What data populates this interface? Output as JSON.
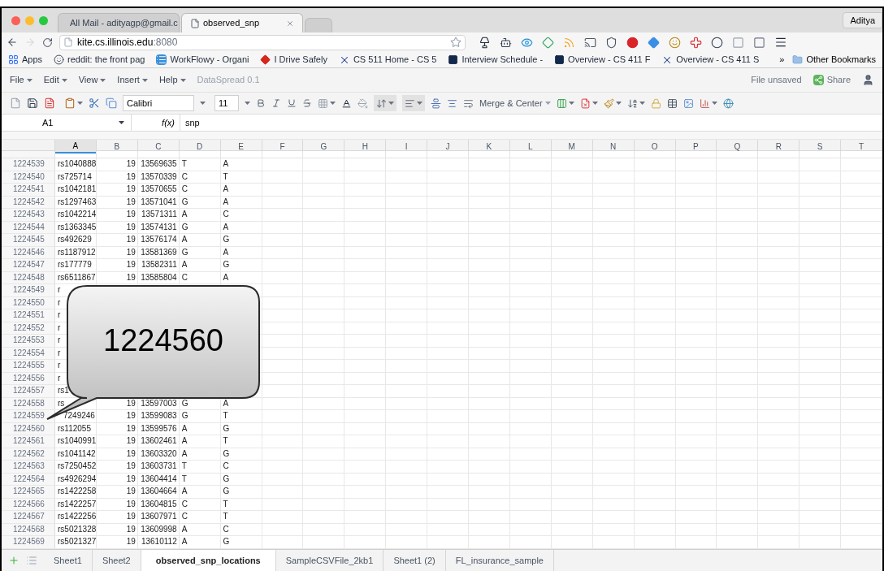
{
  "browser": {
    "tabs": [
      {
        "title": "All Mail - adityagp@gmail.c",
        "kind": "mail",
        "selected": false
      },
      {
        "title": "observed_snp",
        "kind": "doc",
        "selected": true
      }
    ],
    "profile": "Aditya",
    "url": {
      "host": "kite.cs.illinois.edu",
      "port": ":8080"
    },
    "bookmarks": [
      {
        "label": "Apps",
        "kind": "apps"
      },
      {
        "label": "reddit: the front pag",
        "kind": "face"
      },
      {
        "label": "WorkFlowy - Organi",
        "kind": "list"
      },
      {
        "label": "I Drive Safely",
        "kind": "diamond"
      },
      {
        "label": "CS 511 Home - CS 5",
        "kind": "x"
      },
      {
        "label": "Interview Schedule -",
        "kind": "square"
      },
      {
        "label": "Overview - CS 411 F",
        "kind": "square"
      },
      {
        "label": "Overview - CS 411 S",
        "kind": "x"
      }
    ],
    "more": "»",
    "other_bookmarks": "Other Bookmarks"
  },
  "app": {
    "menus": [
      "File",
      "Edit",
      "View",
      "Insert",
      "Help"
    ],
    "product": "DataSpread 0.1",
    "save_status": "File unsaved",
    "share": "Share"
  },
  "toolbar": {
    "font": "Calibri",
    "size": "11",
    "merge": "Merge & Center"
  },
  "formula_bar": {
    "cell": "A1",
    "fx": "f(x)",
    "value": "snp"
  },
  "sheet": {
    "columns": [
      {
        "label": "A",
        "selected": true
      },
      {
        "label": "B",
        "selected": false
      },
      {
        "label": "C",
        "selected": false
      },
      {
        "label": "D",
        "selected": false
      },
      {
        "label": "E",
        "selected": false
      },
      {
        "label": "F",
        "selected": false
      },
      {
        "label": "G",
        "selected": false
      },
      {
        "label": "H",
        "selected": false
      },
      {
        "label": "I",
        "selected": false
      },
      {
        "label": "J",
        "selected": false
      },
      {
        "label": "K",
        "selected": false
      },
      {
        "label": "L",
        "selected": false
      },
      {
        "label": "M",
        "selected": false
      },
      {
        "label": "N",
        "selected": false
      },
      {
        "label": "O",
        "selected": false
      },
      {
        "label": "P",
        "selected": false
      },
      {
        "label": "Q",
        "selected": false
      },
      {
        "label": "R",
        "selected": false
      },
      {
        "label": "S",
        "selected": false
      },
      {
        "label": "T",
        "selected": false
      }
    ],
    "rows": [
      {
        "number": "1224539",
        "cells": [
          "rs1040888",
          "19",
          "13569635",
          "T",
          "A"
        ]
      },
      {
        "number": "1224540",
        "cells": [
          "rs725714",
          "19",
          "13570339",
          "C",
          "T"
        ]
      },
      {
        "number": "1224541",
        "cells": [
          "rs1042181",
          "19",
          "13570655",
          "C",
          "A"
        ]
      },
      {
        "number": "1224542",
        "cells": [
          "rs1297463",
          "19",
          "13571041",
          "G",
          "A"
        ]
      },
      {
        "number": "1224543",
        "cells": [
          "rs1042214",
          "19",
          "13571311",
          "A",
          "C"
        ]
      },
      {
        "number": "1224544",
        "cells": [
          "rs1363345",
          "19",
          "13574131",
          "G",
          "A"
        ]
      },
      {
        "number": "1224545",
        "cells": [
          "rs492629",
          "19",
          "13576174",
          "A",
          "G"
        ]
      },
      {
        "number": "1224546",
        "cells": [
          "rs1187912",
          "19",
          "13581369",
          "G",
          "A"
        ]
      },
      {
        "number": "1224547",
        "cells": [
          "rs177779",
          "19",
          "13582311",
          "A",
          "G"
        ]
      },
      {
        "number": "1224548",
        "cells": [
          "rs6511867",
          "19",
          "13585804",
          "C",
          "A"
        ]
      },
      {
        "number": "1224549",
        "cells": [
          "r"
        ]
      },
      {
        "number": "1224550",
        "cells": [
          "r"
        ]
      },
      {
        "number": "1224551",
        "cells": [
          "r"
        ]
      },
      {
        "number": "1224552",
        "cells": [
          "r"
        ]
      },
      {
        "number": "1224553",
        "cells": [
          "r"
        ]
      },
      {
        "number": "1224554",
        "cells": [
          "r"
        ]
      },
      {
        "number": "1224555",
        "cells": [
          "r"
        ]
      },
      {
        "number": "1224556",
        "cells": [
          "r"
        ]
      },
      {
        "number": "1224557",
        "cells": [
          "rs1"
        ]
      },
      {
        "number": "1224558",
        "cells": [
          "rs",
          "19",
          "13597003",
          "G",
          "A"
        ]
      },
      {
        "number": "1224559",
        "cells": [
          {
            "text": "7249246",
            "kind": "covered"
          },
          "19",
          "13599083",
          "G",
          "T"
        ]
      },
      {
        "number": "1224560",
        "cells": [
          "rs112055",
          "19",
          "13599576",
          "A",
          "G"
        ]
      },
      {
        "number": "1224561",
        "cells": [
          "rs1040991",
          "19",
          "13602461",
          "A",
          "T"
        ]
      },
      {
        "number": "1224562",
        "cells": [
          "rs1041142",
          "19",
          "13603320",
          "A",
          "G"
        ]
      },
      {
        "number": "1224563",
        "cells": [
          "rs7250452",
          "19",
          "13603731",
          "T",
          "C"
        ]
      },
      {
        "number": "1224564",
        "cells": [
          "rs4926294",
          "19",
          "13604414",
          "T",
          "G"
        ]
      },
      {
        "number": "1224565",
        "cells": [
          "rs1422258",
          "19",
          "13604664",
          "A",
          "G"
        ]
      },
      {
        "number": "1224566",
        "cells": [
          "rs1422257",
          "19",
          "13604815",
          "C",
          "T"
        ]
      },
      {
        "number": "1224567",
        "cells": [
          "rs1422256",
          "19",
          "13607971",
          "C",
          "T"
        ]
      },
      {
        "number": "1224568",
        "cells": [
          "rs5021328",
          "19",
          "13609998",
          "A",
          "C"
        ]
      },
      {
        "number": "1224569",
        "cells": [
          "rs5021327",
          "19",
          "13610112",
          "A",
          "G"
        ]
      }
    ]
  },
  "sheet_tabs": [
    {
      "label": "Sheet1",
      "selected": false
    },
    {
      "label": "Sheet2",
      "selected": false
    },
    {
      "label": "observed_snp_locations",
      "selected": true
    },
    {
      "label": "SampleCSVFile_2kb1",
      "selected": false
    },
    {
      "label": "Sheet1 (2)",
      "selected": false
    },
    {
      "label": "FL_insurance_sample",
      "selected": false
    }
  ],
  "callout": {
    "text": "1224560"
  }
}
